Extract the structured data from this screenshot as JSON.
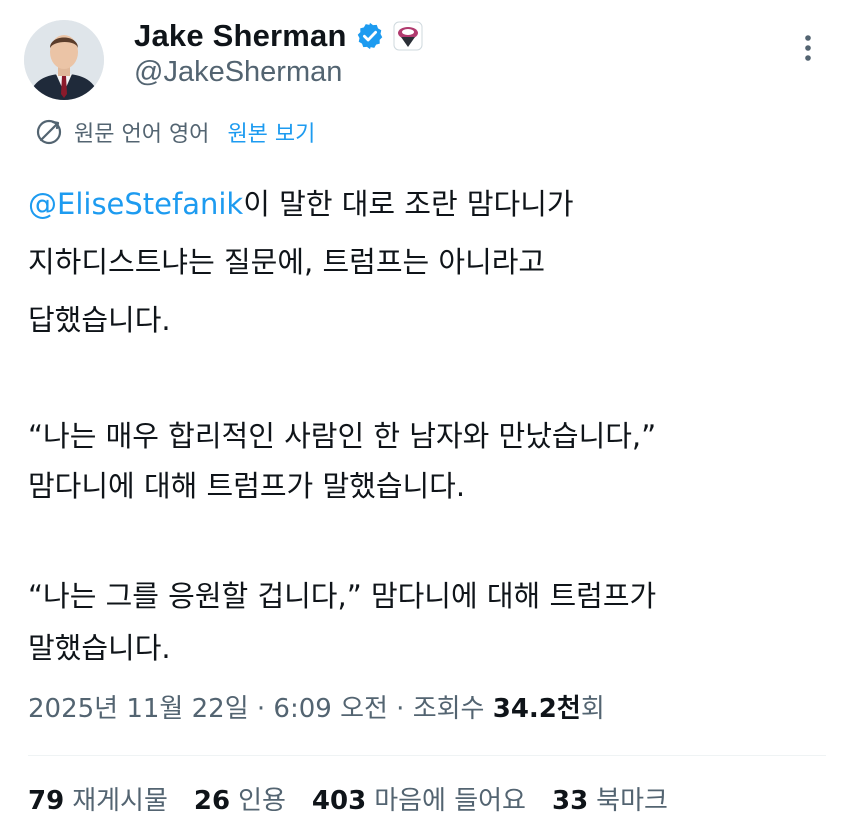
{
  "author": {
    "display_name": "Jake Sherman",
    "handle": "@JakeSherman"
  },
  "translation": {
    "label": "원문 언어 영어",
    "link": "원본 보기"
  },
  "tweet": {
    "mention": "@EliseStefanik",
    "line1_rest": "이 말한 대로 조란 맘다니가",
    "line2": "지하디스트냐는 질문에, 트럼프는 아니라고",
    "line3": "답했습니다.",
    "line4": "“나는 매우 합리적인 사람인 한 남자와 만났습니다,”",
    "line5": "맘다니에 대해 트럼프가 말했습니다.",
    "line6": "“나는 그를 응원할 겁니다,” 맘다니에 대해 트럼프가",
    "line7": "말했습니다."
  },
  "meta": {
    "timestamp": "2025년 11월 22일 · 6:09 오전 · 조회수 ",
    "views": "34.2천",
    "views_suffix": "회"
  },
  "stats": {
    "reposts_count": "79",
    "reposts_label": "재게시물",
    "quotes_count": "26",
    "quotes_label": "인용",
    "likes_count": "403",
    "likes_label": "마음에 들어요",
    "bookmarks_count": "33",
    "bookmarks_label": "북마크"
  },
  "colors": {
    "link": "#1d9bf0",
    "text": "#0f1419",
    "secondary": "#536471",
    "verified": "#1d9bf0"
  },
  "icons": {
    "verified": "verified-badge-icon",
    "affiliate": "affiliate-badge-icon",
    "more": "more-options-icon",
    "translate": "translate-icon"
  }
}
